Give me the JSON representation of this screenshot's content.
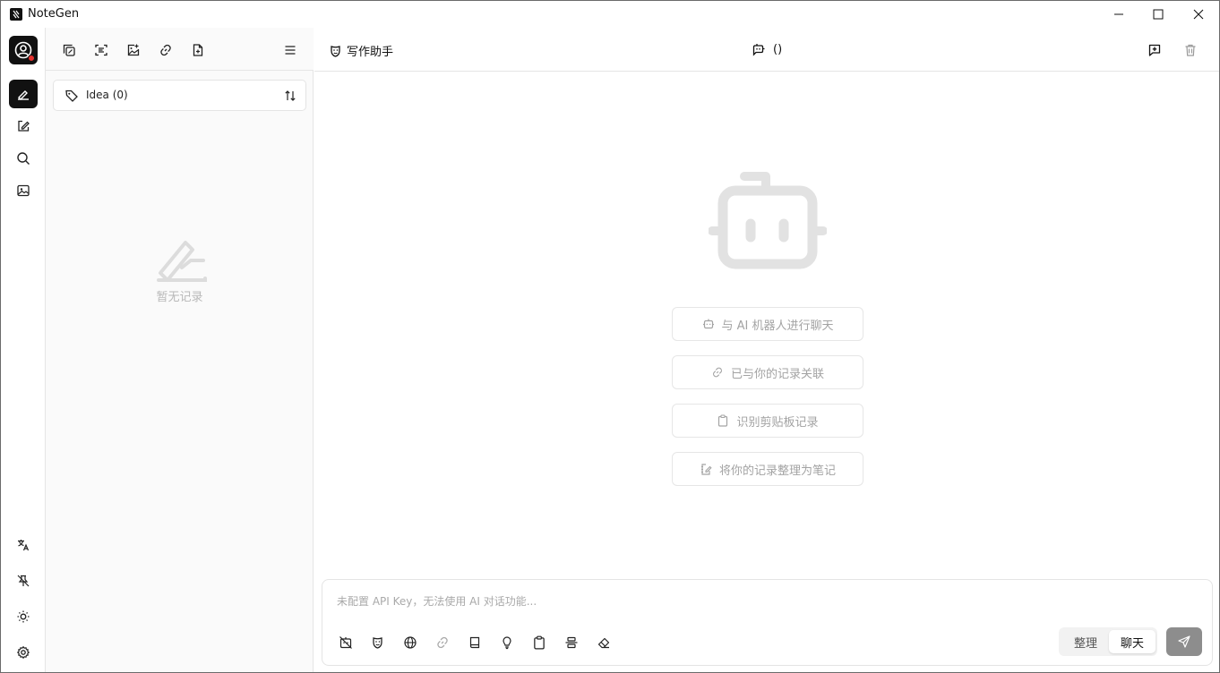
{
  "window": {
    "title": "NoteGen"
  },
  "rail": {
    "icons": [
      "profile-icon",
      "pen-icon",
      "edit-icon",
      "search-icon",
      "image-icon",
      "translate-icon",
      "pin-off-icon",
      "sun-icon",
      "settings-icon"
    ]
  },
  "record_panel": {
    "tag_selector": {
      "label": "Idea (0)"
    },
    "empty_text": "暂无记录"
  },
  "chat": {
    "header": {
      "prompt_label": "写作助手",
      "model_label": "()"
    },
    "suggestions": [
      {
        "icon": "bot-icon",
        "label": "与 AI 机器人进行聊天"
      },
      {
        "icon": "link-icon",
        "label": "已与你的记录关联"
      },
      {
        "icon": "clipboard-icon",
        "label": "识别剪贴板记录"
      },
      {
        "icon": "note-icon",
        "label": "将你的记录整理为笔记"
      }
    ],
    "composer": {
      "placeholder": "未配置 API Key，无法使用 AI 对话功能...",
      "value": "",
      "mode_options": [
        "整理",
        "聊天"
      ],
      "selected_mode": "聊天"
    }
  },
  "colors": {
    "accent": "#111111",
    "badge": "#e5312e",
    "muted": "#a3a3a3"
  }
}
